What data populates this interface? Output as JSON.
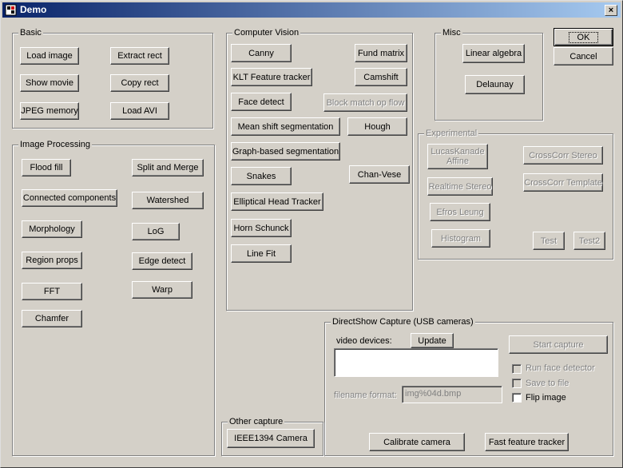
{
  "window": {
    "title": "Demo",
    "close_glyph": "×"
  },
  "groups": {
    "basic": "Basic",
    "image_processing": "Image Processing",
    "computer_vision": "Computer Vision",
    "misc": "Misc",
    "experimental": "Experimental",
    "directshow": "DirectShow Capture (USB cameras)",
    "other_capture": "Other capture"
  },
  "basic": {
    "load_image": "Load image",
    "extract_rect": "Extract rect",
    "show_movie": "Show movie",
    "copy_rect": "Copy rect",
    "jpeg_memory": "JPEG memory",
    "load_avi": "Load AVI"
  },
  "image_processing": {
    "flood_fill": "Flood fill",
    "split_merge": "Split and Merge",
    "connected_components": "Connected components",
    "watershed": "Watershed",
    "morphology": "Morphology",
    "log": "LoG",
    "region_props": "Region props",
    "edge_detect": "Edge detect",
    "fft": "FFT",
    "warp": "Warp",
    "chamfer": "Chamfer"
  },
  "computer_vision": {
    "canny": "Canny",
    "fund_matrix": "Fund matrix",
    "klt": "KLT Feature tracker",
    "camshift": "Camshift",
    "face_detect": "Face detect",
    "block_match": "Block match op flow",
    "mean_shift": "Mean shift segmentation",
    "hough": "Hough",
    "graph_seg": "Graph-based segmentation",
    "snakes": "Snakes",
    "chan_vese": "Chan-Vese",
    "elliptical": "Elliptical Head Tracker",
    "horn_schunck": "Horn Schunck",
    "line_fit": "Line Fit"
  },
  "misc": {
    "linear_algebra": "Linear algebra",
    "delaunay": "Delaunay"
  },
  "dialog": {
    "ok": "OK",
    "cancel": "Cancel"
  },
  "experimental": {
    "lucas_kanade": "LucasKanade Affine",
    "crosscorr_stereo": "CrossCorr Stereo",
    "realtime_stereo": "Realtime Stereo",
    "crosscorr_template": "CrossCorr Template",
    "efros_leung": "Efros Leung",
    "histogram": "Histogram",
    "test": "Test",
    "test2": "Test2"
  },
  "directshow": {
    "video_devices_label": "video devices:",
    "update": "Update",
    "start_capture": "Start capture",
    "run_face_detector": "Run face detector",
    "save_to_file": "Save to file",
    "flip_image": "Flip image",
    "filename_format_label": "filename format:",
    "filename_format_value": "img%04d.bmp",
    "calibrate_camera": "Calibrate camera",
    "fast_feature_tracker": "Fast feature tracker"
  },
  "other_capture": {
    "ieee1394": "IEEE1394 Camera"
  }
}
